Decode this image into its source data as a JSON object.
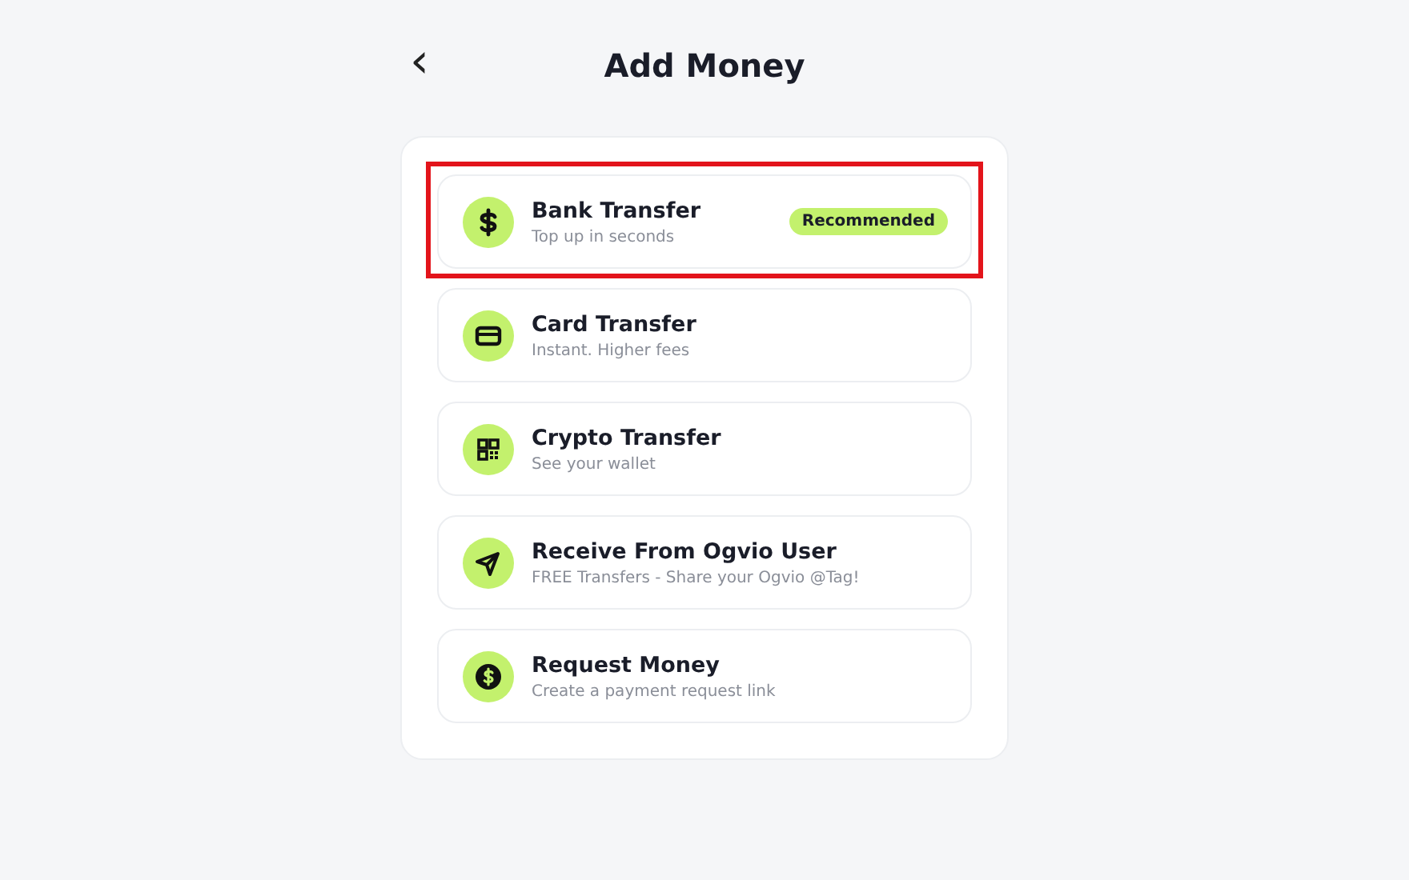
{
  "header": {
    "back": "‹",
    "title": "Add Money"
  },
  "items": [
    {
      "kind": "dollar",
      "title": "Bank Transfer",
      "subtitle": "Top up in seconds",
      "badge": "Recommended",
      "highlighted": true
    },
    {
      "kind": "card",
      "title": "Card Transfer",
      "subtitle": "Instant. Higher fees",
      "highlighted": false
    },
    {
      "kind": "qr",
      "title": "Crypto Transfer",
      "subtitle": "See your wallet",
      "highlighted": false
    },
    {
      "kind": "send",
      "title": "Receive From Ogvio User",
      "subtitle": "FREE Transfers - Share your Ogvio @Tag!",
      "highlighted": false
    },
    {
      "kind": "coin",
      "title": "Request Money",
      "subtitle": "Create a payment request link",
      "highlighted": false
    }
  ]
}
